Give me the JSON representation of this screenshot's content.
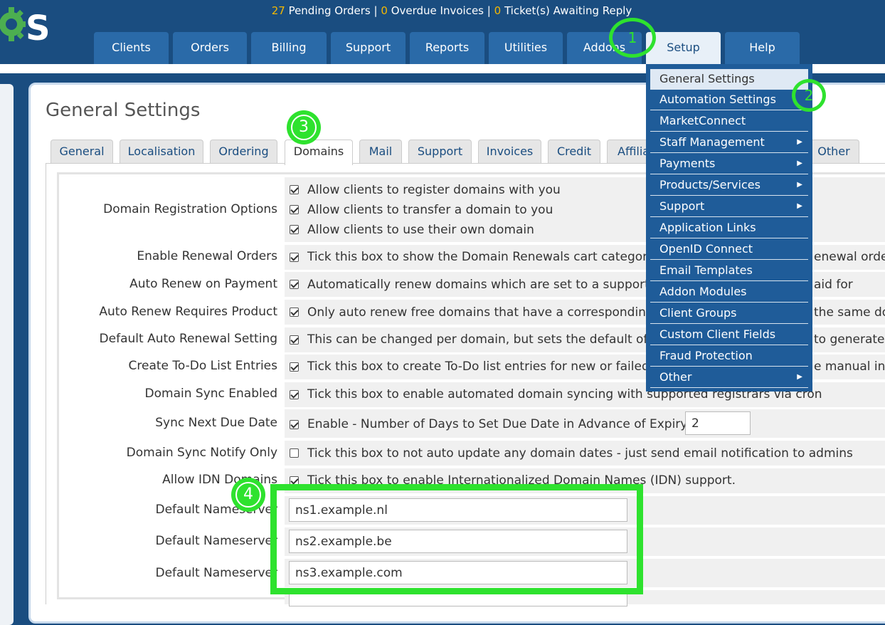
{
  "header": {
    "stats": {
      "pending_orders_count": "27",
      "pending_orders_label": "Pending Orders",
      "separator": "|",
      "overdue_invoices_count": "0",
      "overdue_invoices_label": "Overdue Invoices",
      "tickets_count": "0",
      "tickets_label": "Ticket(s) Awaiting Reply"
    },
    "nav": [
      "Clients",
      "Orders",
      "Billing",
      "Support",
      "Reports",
      "Utilities",
      "Addons",
      "Setup",
      "Help"
    ],
    "active_nav": "Setup"
  },
  "page": {
    "title": "General Settings",
    "tabs": [
      "General",
      "Localisation",
      "Ordering",
      "Domains",
      "Mail",
      "Support",
      "Invoices",
      "Credit",
      "Affiliates",
      "Other"
    ],
    "active_tab": "Domains"
  },
  "settings": {
    "reg_options_label": "Domain Registration Options",
    "reg_opt_1": "Allow clients to register domains with you",
    "reg_opt_2": "Allow clients to transfer a domain to you",
    "reg_opt_3": "Allow clients to use their own domain",
    "renewal_orders_label": "Enable Renewal Orders",
    "renewal_orders_text": "Tick this box to show the Domain Renewals cart category",
    "renewal_orders_text_end": "enewal order",
    "auto_renew_label": "Auto Renew on Payment",
    "auto_renew_text": "Automatically renew domains which are set to a support",
    "auto_renew_text_end": "aid for",
    "auto_renew_product_label": "Auto Renew Requires Product",
    "auto_renew_product_text": "Only auto renew free domains that have a corresponding",
    "auto_renew_product_text_end": "the same do",
    "default_auto_renewal_label": "Default Auto Renewal Setting",
    "default_auto_renewal_text": "This can be changed per domain, but sets the default of t",
    "default_auto_renewal_text_end": "to generate f",
    "todo_label": "Create To-Do List Entries",
    "todo_text": "Tick this box to create To-Do list entries for new or failed",
    "todo_text_end": "e manual int",
    "sync_enabled_label": "Domain Sync Enabled",
    "sync_enabled_text": "Tick this box to enable automated domain syncing with supported registrars via cron",
    "sync_due_label": "Sync Next Due Date",
    "sync_due_text": "Enable - Number of Days to Set Due Date in Advance of Expiry:",
    "sync_due_value": "2",
    "sync_notify_label": "Domain Sync Notify Only",
    "sync_notify_text": "Tick this box to not auto update any domain dates - just send email notification to admins",
    "idn_label": "Allow IDN Domains",
    "idn_text": "Tick this box to enable Internationalized Domain Names (IDN) support.",
    "ns_label": "Default Nameserver",
    "ns1": "ns1.example.nl",
    "ns2": "ns2.example.be",
    "ns3": "ns3.example.com"
  },
  "setup_menu": {
    "items": [
      {
        "label": "General Settings",
        "submenu": false
      },
      {
        "label": "Automation Settings",
        "submenu": false
      },
      {
        "label": "MarketConnect",
        "submenu": false
      },
      {
        "label": "Staff Management",
        "submenu": true
      },
      {
        "label": "Payments",
        "submenu": true
      },
      {
        "label": "Products/Services",
        "submenu": true
      },
      {
        "label": "Support",
        "submenu": true
      },
      {
        "label": "Application Links",
        "submenu": false
      },
      {
        "label": "OpenID Connect",
        "submenu": false
      },
      {
        "label": "Email Templates",
        "submenu": false
      },
      {
        "label": "Addon Modules",
        "submenu": false
      },
      {
        "label": "Client Groups",
        "submenu": false
      },
      {
        "label": "Custom Client Fields",
        "submenu": false
      },
      {
        "label": "Fraud Protection",
        "submenu": false
      },
      {
        "label": "Other",
        "submenu": true
      }
    ],
    "arrow": "▶"
  },
  "annotations": [
    "1",
    "2",
    "3",
    "4"
  ],
  "colors": {
    "header_bg": "#1a4d80",
    "nav_tab": "#2a6aa8",
    "menu_bg": "#1f5c99",
    "annotation": "#2ee22e",
    "stat_number": "#f5b800"
  }
}
